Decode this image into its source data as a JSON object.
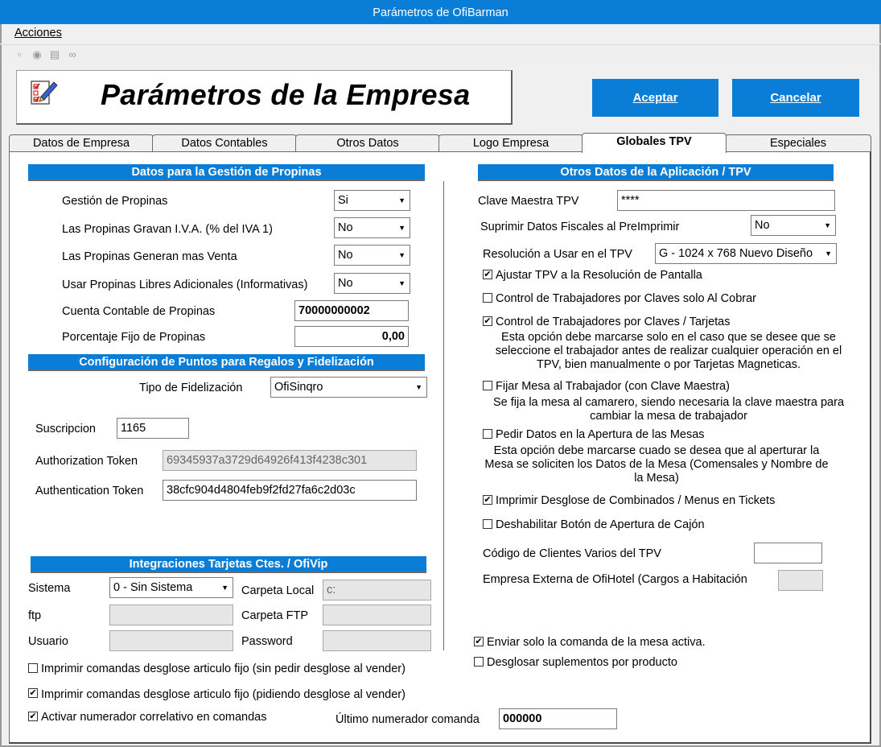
{
  "window": {
    "title": "Parámetros de OfiBarman"
  },
  "menu": {
    "acciones": "Acciones"
  },
  "header": {
    "title": "Parámetros de la Empresa",
    "accept": "Aceptar",
    "cancel": "Cancelar"
  },
  "tabs": [
    "Datos de Empresa",
    "Datos Contables",
    "Otros Datos",
    "Logo Empresa",
    "Globales TPV",
    "Especiales"
  ],
  "propinas": {
    "section": "Datos para la Gestión de Propinas",
    "gestion_label": "Gestión de Propinas",
    "gestion_value": "Si",
    "iva_label": "Las Propinas Gravan I.V.A. (% del IVA 1)",
    "iva_value": "No",
    "venta_label": "Las Propinas Generan mas Venta",
    "venta_value": "No",
    "libres_label": "Usar Propinas Libres Adicionales (Informativas)",
    "libres_value": "No",
    "cuenta_label": "Cuenta Contable de Propinas",
    "cuenta_value": "70000000002",
    "porcentaje_label": "Porcentaje Fijo de Propinas",
    "porcentaje_value": "0,00"
  },
  "fidelizacion": {
    "section": "Configuración de Puntos para Regalos y Fidelización",
    "tipo_label": "Tipo de Fidelización",
    "tipo_value": "OfiSinqro",
    "suscripcion_label": "Suscripcion",
    "suscripcion_value": "1165",
    "authz_label": "Authorization Token",
    "authz_value": "69345937a3729d64926f413f4238c301",
    "authn_label": "Authentication Token",
    "authn_value": "38cfc904d4804feb9f2fd27fa6c2d03c"
  },
  "integraciones": {
    "section": "Integraciones Tarjetas Ctes. / OfiVip",
    "sistema_label": "Sistema",
    "sistema_value": "0 - Sin Sistema",
    "carpeta_local_label": "Carpeta Local",
    "carpeta_local_value": "c:",
    "ftp_label": "ftp",
    "ftp_value": "",
    "carpeta_ftp_label": "Carpeta FTP",
    "carpeta_ftp_value": "",
    "usuario_label": "Usuario",
    "usuario_value": "",
    "password_label": "Password",
    "password_value": ""
  },
  "bottom": {
    "desglose_sin_pedir": "Imprimir comandas desglose articulo fijo (sin pedir desglose al vender)",
    "desglose_sin_pedir_checked": false,
    "desglose_pidiendo": "Imprimir comandas desglose articulo fijo (pidiendo desglose al vender)",
    "desglose_pidiendo_checked": true,
    "numerador": "Activar numerador correlativo en comandas",
    "numerador_checked": true,
    "ultimo_label": "Último numerador comanda",
    "ultimo_value": "000000"
  },
  "otros": {
    "section": "Otros Datos de la Aplicación / TPV",
    "clave_label": "Clave Maestra TPV",
    "clave_value": "****",
    "suprimir_label": "Suprimir Datos Fiscales al PreImprimir",
    "suprimir_value": "No",
    "resolucion_label": "Resolución a Usar en el TPV",
    "resolucion_value": "G - 1024 x 768 Nuevo Diseño",
    "ajustar": "Ajustar TPV a la Resolución de Pantalla",
    "ajustar_checked": true,
    "control_cobrar": "Control de Trabajadores por Claves solo Al Cobrar",
    "control_cobrar_checked": false,
    "control_claves": "Control de Trabajadores por Claves / Tarjetas",
    "control_claves_checked": true,
    "control_claves_note": [
      "Esta opción debe marcarse solo en el caso que se desee que se",
      "seleccione el trabajador antes de realizar cualquier operación en el",
      "TPV, bien manualmente o por Tarjetas Magneticas."
    ],
    "fijar_mesa": "Fijar Mesa al Trabajador (con Clave Maestra)",
    "fijar_mesa_checked": false,
    "fijar_mesa_note": [
      "Se fija la mesa al camarero, siendo necesaria la clave maestra para",
      "cambiar la mesa de trabajador"
    ],
    "pedir_datos": "Pedir Datos en la Apertura de las Mesas",
    "pedir_datos_checked": false,
    "pedir_datos_note": [
      "Esta opción debe marcarse cuado se desea que al aperturar la",
      "Mesa se soliciten los Datos de la Mesa (Comensales y Nombre de",
      "la Mesa)"
    ],
    "imprimir_desglose": "Imprimir Desglose de Combinados / Menus en Tickets",
    "imprimir_desglose_checked": true,
    "deshabilitar_cajon": "Deshabilitar Botón de Apertura de Cajón",
    "deshabilitar_cajon_checked": false,
    "codigo_clientes_label": "Código de Clientes Varios del TPV",
    "codigo_clientes_value": "",
    "empresa_externa_label": "Empresa Externa de OfiHotel (Cargos a Habitación",
    "empresa_externa_value": "",
    "enviar_comanda": "Enviar solo la comanda de la mesa activa.",
    "enviar_comanda_checked": true,
    "desglosar_suplementos": "Desglosar suplementos por producto",
    "desglosar_suplementos_checked": false
  }
}
